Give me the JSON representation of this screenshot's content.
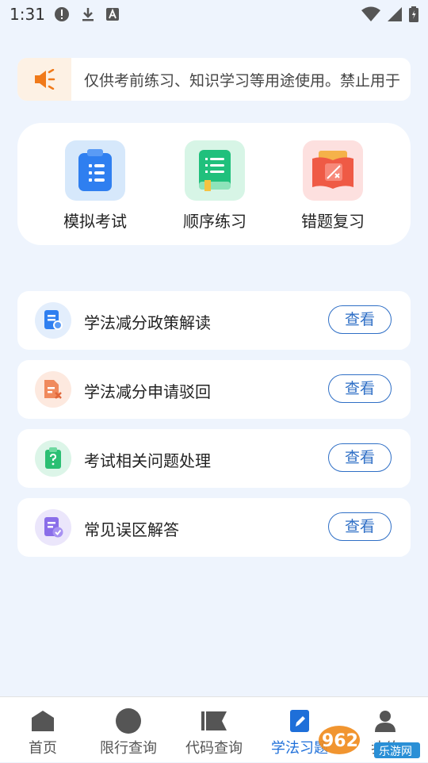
{
  "status_bar": {
    "time": "1:31"
  },
  "notice": {
    "text": "仅供考前练习、知识学习等用途使用。禁止用于"
  },
  "quick_actions": [
    {
      "label": "模拟考试",
      "icon": "clipboard-list-icon",
      "bg": "#d6e8fb",
      "color": "#2f7ff0"
    },
    {
      "label": "顺序练习",
      "icon": "green-book-icon",
      "bg": "#d7f5e6",
      "color": "#20c07c"
    },
    {
      "label": "错题复习",
      "icon": "red-book-icon",
      "bg": "#fde0df",
      "color": "#ef5a45"
    }
  ],
  "list_items": [
    {
      "label": "学法减分政策解读",
      "button": "查看",
      "icon": "policy-document-icon",
      "bg": "#e3eefc",
      "color": "#2f7ff0"
    },
    {
      "label": "学法减分申请驳回",
      "button": "查看",
      "icon": "reject-document-icon",
      "bg": "#fde9df",
      "color": "#f08a5d"
    },
    {
      "label": "考试相关问题处理",
      "button": "查看",
      "icon": "question-clipboard-icon",
      "bg": "#dcf5e8",
      "color": "#2bbf73"
    },
    {
      "label": "常见误区解答",
      "button": "查看",
      "icon": "checklist-icon",
      "bg": "#ebe6fb",
      "color": "#8a6ee9"
    }
  ],
  "bottom_nav": [
    {
      "label": "首页",
      "icon": "home-icon",
      "active": false
    },
    {
      "label": "限行查询",
      "icon": "circle-icon",
      "active": false
    },
    {
      "label": "代码查询",
      "icon": "flag-icon",
      "active": false
    },
    {
      "label": "学法习题",
      "icon": "pen-icon",
      "active": true
    },
    {
      "label": "我的",
      "icon": "user-icon",
      "active": false
    }
  ],
  "watermark": {
    "text": "962.NET",
    "subtext": "乐游网"
  },
  "colors": {
    "accent": "#1e6fd9",
    "background": "#eef4fd",
    "notice_icon": "#f07a1a"
  }
}
